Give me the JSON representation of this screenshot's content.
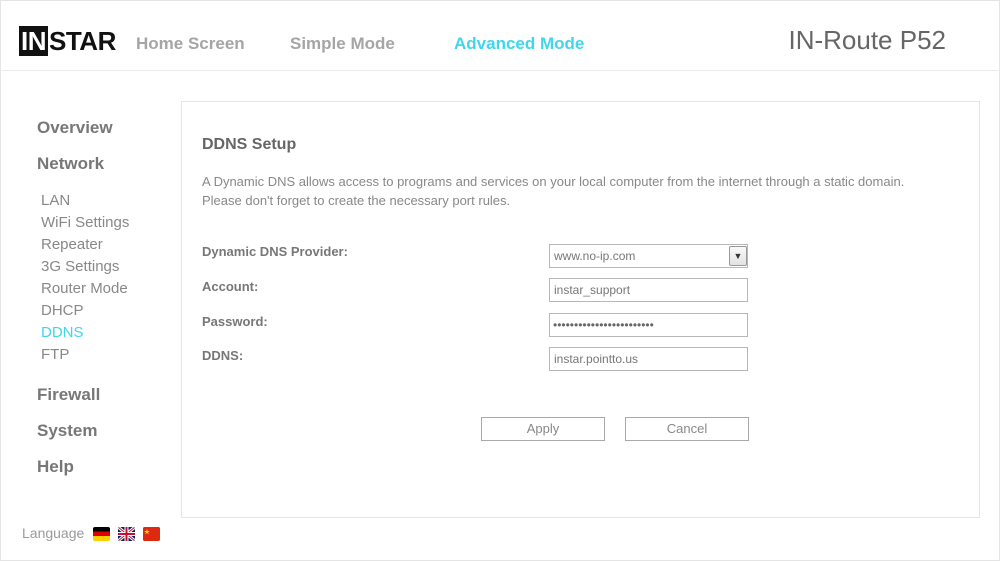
{
  "header": {
    "logo_boxed": "IN",
    "logo_rest": "STAR",
    "nav": [
      "Home Screen",
      "Simple Mode",
      "Advanced Mode"
    ],
    "active_nav": "Advanced Mode",
    "model": "IN-Route P52"
  },
  "sidebar": {
    "overview": "Overview",
    "network": "Network",
    "network_items": [
      "LAN",
      "WiFi Settings",
      "Repeater",
      "3G Settings",
      "Router Mode",
      "DHCP",
      "DDNS",
      "FTP"
    ],
    "active_item": "DDNS",
    "firewall": "Firewall",
    "system": "System",
    "help": "Help"
  },
  "language": {
    "label": "Language",
    "flags": [
      "flag-de-icon",
      "flag-uk-icon",
      "flag-cn-icon"
    ]
  },
  "ddns": {
    "title": "DDNS Setup",
    "description": "A Dynamic DNS allows access to programs and services on your local computer from the internet through a static domain. Please don't forget to create the necessary port rules.",
    "provider_label": "Dynamic DNS Provider:",
    "provider_value": "www.no-ip.com",
    "account_label": "Account:",
    "account_value": "instar_support",
    "password_label": "Password:",
    "password_mask": "••••••••••••••••••••••••",
    "ddns_label": "DDNS:",
    "ddns_value": "instar.pointto.us",
    "apply": "Apply",
    "cancel": "Cancel"
  },
  "colors": {
    "accent": "#3fd6ee",
    "text": "#777777",
    "border": "#b7b7b7"
  }
}
